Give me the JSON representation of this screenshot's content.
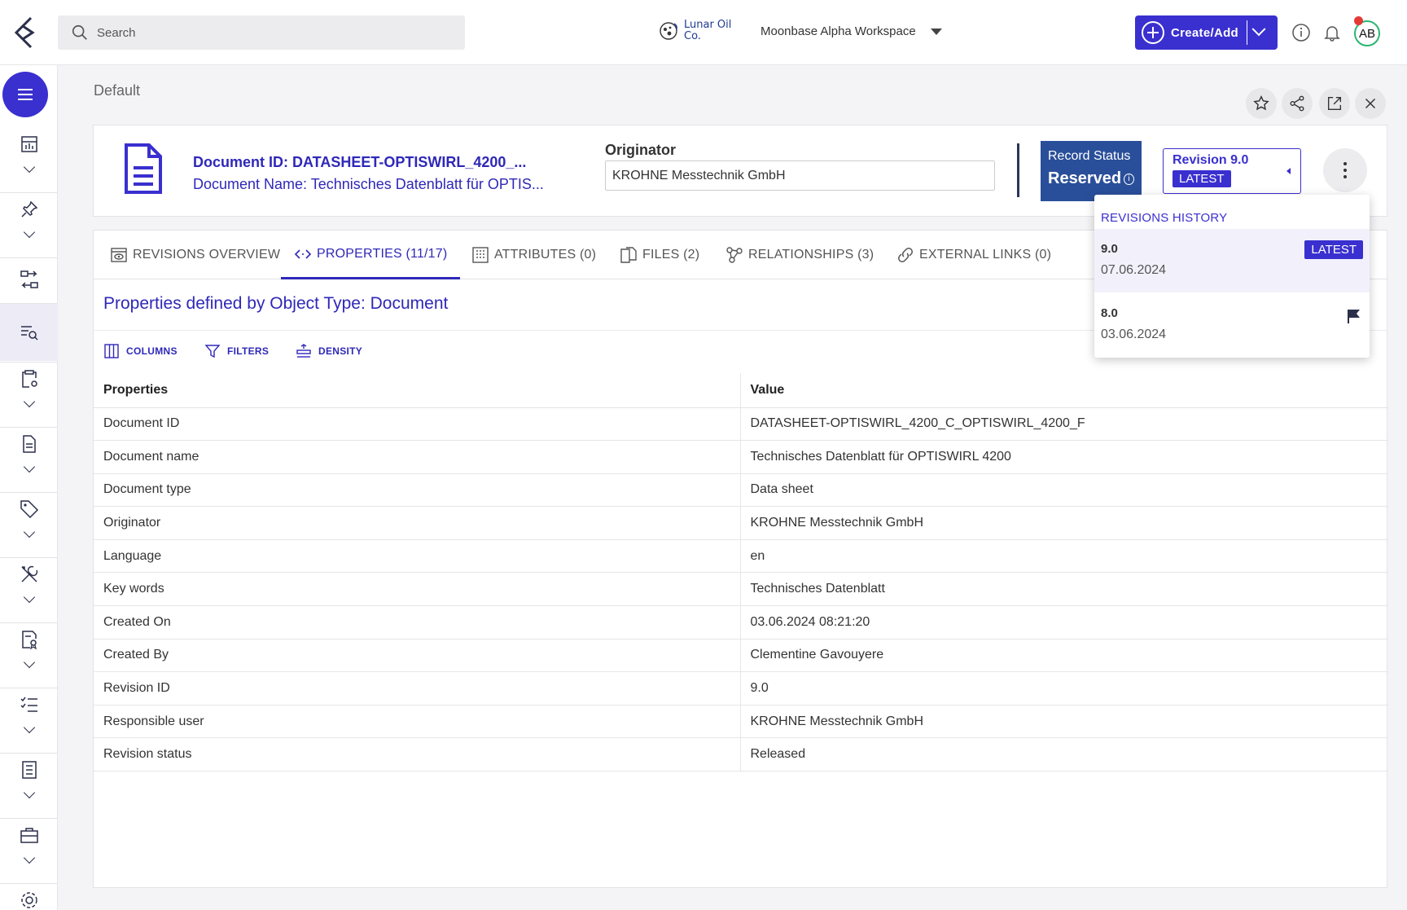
{
  "topbar": {
    "search_placeholder": "Search",
    "company_name": "Lunar Oil Co.",
    "workspace": "Moonbase Alpha Workspace",
    "create_label": "Create/Add",
    "avatar_initials": "AB"
  },
  "breadcrumb": "Default",
  "document": {
    "id_line": "Document ID: DATASHEET-OPTISWIRL_4200_...",
    "name_line": "Document Name: Technisches Datenblatt für OPTIS...",
    "originator_label": "Originator",
    "originator_value": "KROHNE Messtechnik GmbH",
    "record_status_label": "Record Status",
    "record_status_value": "Reserved",
    "revision_label": "Revision 9.0",
    "revision_badge": "LATEST"
  },
  "tabs": [
    {
      "label": "REVISIONS OVERVIEW",
      "icon": "eye-box-icon"
    },
    {
      "label": "PROPERTIES (11/17)",
      "icon": "code-icon",
      "active": true
    },
    {
      "label": "ATTRIBUTES (0)",
      "icon": "grid-icon"
    },
    {
      "label": "FILES (2)",
      "icon": "files-icon"
    },
    {
      "label": "RELATIONSHIPS (3)",
      "icon": "network-icon"
    },
    {
      "label": "EXTERNAL LINKS (0)",
      "icon": "link-icon"
    }
  ],
  "section_title": "Properties defined by Object Type: Document",
  "toolbar": {
    "columns": "COLUMNS",
    "filters": "FILTERS",
    "density": "DENSITY"
  },
  "table": {
    "headers": [
      "Properties",
      "Value"
    ],
    "rows": [
      [
        "Document ID",
        "DATASHEET-OPTISWIRL_4200_C_OPTISWIRL_4200_F"
      ],
      [
        "Document name",
        "Technisches Datenblatt für OPTISWIRL 4200"
      ],
      [
        "Document type",
        "Data sheet"
      ],
      [
        "Originator",
        "KROHNE Messtechnik GmbH"
      ],
      [
        "Language",
        "en"
      ],
      [
        "Key words",
        "Technisches Datenblatt"
      ],
      [
        "Created On",
        "03.06.2024 08:21:20"
      ],
      [
        "Created By",
        "Clementine Gavouyere"
      ],
      [
        "Revision ID",
        "9.0"
      ],
      [
        "Responsible user",
        "KROHNE Messtechnik GmbH"
      ],
      [
        "Revision status",
        "Released"
      ]
    ]
  },
  "revisions_popover": {
    "title": "REVISIONS HISTORY",
    "items": [
      {
        "number": "9.0",
        "date": "07.06.2024",
        "badge": "LATEST"
      },
      {
        "number": "8.0",
        "date": "03.06.2024"
      }
    ]
  },
  "colors": {
    "accent": "#3a2fcf",
    "link": "#2f28b8",
    "status_bg": "#2a4f9a"
  }
}
